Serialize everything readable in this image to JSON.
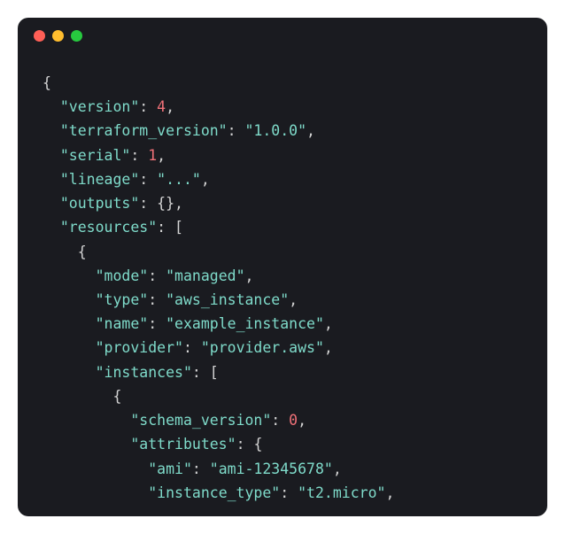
{
  "code": {
    "lines": [
      {
        "indent": 0,
        "tokens": [
          {
            "t": "brace",
            "v": "{"
          }
        ]
      },
      {
        "indent": 1,
        "tokens": [
          {
            "t": "key",
            "v": "\"version\""
          },
          {
            "t": "colon",
            "v": ": "
          },
          {
            "t": "number",
            "v": "4"
          },
          {
            "t": "comma",
            "v": ","
          }
        ]
      },
      {
        "indent": 1,
        "tokens": [
          {
            "t": "key",
            "v": "\"terraform_version\""
          },
          {
            "t": "colon",
            "v": ": "
          },
          {
            "t": "string",
            "v": "\"1.0.0\""
          },
          {
            "t": "comma",
            "v": ","
          }
        ]
      },
      {
        "indent": 1,
        "tokens": [
          {
            "t": "key",
            "v": "\"serial\""
          },
          {
            "t": "colon",
            "v": ": "
          },
          {
            "t": "number",
            "v": "1"
          },
          {
            "t": "comma",
            "v": ","
          }
        ]
      },
      {
        "indent": 1,
        "tokens": [
          {
            "t": "key",
            "v": "\"lineage\""
          },
          {
            "t": "colon",
            "v": ": "
          },
          {
            "t": "string",
            "v": "\"...\""
          },
          {
            "t": "comma",
            "v": ","
          }
        ]
      },
      {
        "indent": 1,
        "tokens": [
          {
            "t": "key",
            "v": "\"outputs\""
          },
          {
            "t": "colon",
            "v": ": "
          },
          {
            "t": "brace",
            "v": "{}"
          },
          {
            "t": "comma",
            "v": ","
          }
        ]
      },
      {
        "indent": 1,
        "tokens": [
          {
            "t": "key",
            "v": "\"resources\""
          },
          {
            "t": "colon",
            "v": ": "
          },
          {
            "t": "bracket",
            "v": "["
          }
        ]
      },
      {
        "indent": 2,
        "tokens": [
          {
            "t": "brace",
            "v": "{"
          }
        ]
      },
      {
        "indent": 3,
        "tokens": [
          {
            "t": "key",
            "v": "\"mode\""
          },
          {
            "t": "colon",
            "v": ": "
          },
          {
            "t": "string",
            "v": "\"managed\""
          },
          {
            "t": "comma",
            "v": ","
          }
        ]
      },
      {
        "indent": 3,
        "tokens": [
          {
            "t": "key",
            "v": "\"type\""
          },
          {
            "t": "colon",
            "v": ": "
          },
          {
            "t": "string",
            "v": "\"aws_instance\""
          },
          {
            "t": "comma",
            "v": ","
          }
        ]
      },
      {
        "indent": 3,
        "tokens": [
          {
            "t": "key",
            "v": "\"name\""
          },
          {
            "t": "colon",
            "v": ": "
          },
          {
            "t": "string",
            "v": "\"example_instance\""
          },
          {
            "t": "comma",
            "v": ","
          }
        ]
      },
      {
        "indent": 3,
        "tokens": [
          {
            "t": "key",
            "v": "\"provider\""
          },
          {
            "t": "colon",
            "v": ": "
          },
          {
            "t": "string",
            "v": "\"provider.aws\""
          },
          {
            "t": "comma",
            "v": ","
          }
        ]
      },
      {
        "indent": 3,
        "tokens": [
          {
            "t": "key",
            "v": "\"instances\""
          },
          {
            "t": "colon",
            "v": ": "
          },
          {
            "t": "bracket",
            "v": "["
          }
        ]
      },
      {
        "indent": 4,
        "tokens": [
          {
            "t": "brace",
            "v": "{"
          }
        ]
      },
      {
        "indent": 5,
        "tokens": [
          {
            "t": "key",
            "v": "\"schema_version\""
          },
          {
            "t": "colon",
            "v": ": "
          },
          {
            "t": "number",
            "v": "0"
          },
          {
            "t": "comma",
            "v": ","
          }
        ]
      },
      {
        "indent": 5,
        "tokens": [
          {
            "t": "key",
            "v": "\"attributes\""
          },
          {
            "t": "colon",
            "v": ": "
          },
          {
            "t": "brace",
            "v": "{"
          }
        ]
      },
      {
        "indent": 6,
        "tokens": [
          {
            "t": "key",
            "v": "\"ami\""
          },
          {
            "t": "colon",
            "v": ": "
          },
          {
            "t": "string",
            "v": "\"ami-12345678\""
          },
          {
            "t": "comma",
            "v": ","
          }
        ]
      },
      {
        "indent": 6,
        "tokens": [
          {
            "t": "key",
            "v": "\"instance_type\""
          },
          {
            "t": "colon",
            "v": ": "
          },
          {
            "t": "string",
            "v": "\"t2.micro\""
          },
          {
            "t": "comma",
            "v": ","
          }
        ]
      }
    ]
  }
}
